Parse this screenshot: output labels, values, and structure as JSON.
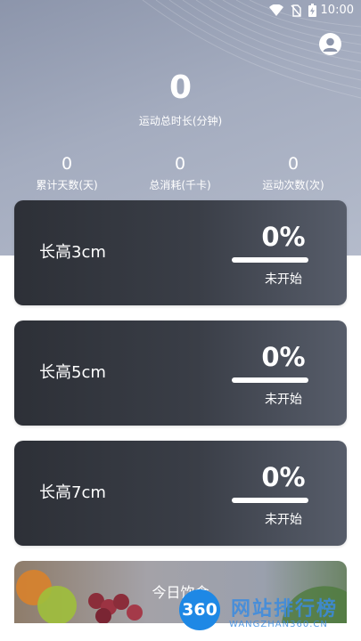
{
  "status_bar": {
    "time": "10:00"
  },
  "summary": {
    "total_value": "0",
    "total_label": "运动总时长(分钟)",
    "stats": [
      {
        "value": "0",
        "label": "累计天数(天)"
      },
      {
        "value": "0",
        "label": "总消耗(千卡)"
      },
      {
        "value": "0",
        "label": "运动次数(次)"
      }
    ]
  },
  "plans": [
    {
      "name": "长高3cm",
      "percent": "0%",
      "status": "未开始"
    },
    {
      "name": "长高5cm",
      "percent": "0%",
      "status": "未开始"
    },
    {
      "name": "长高7cm",
      "percent": "0%",
      "status": "未开始"
    }
  ],
  "diet": {
    "title": "今日饮食"
  },
  "watermark": {
    "logo": "360",
    "text": "网站排行榜",
    "sub": "WANGZHAN360.CN"
  },
  "colors": {
    "header": "#9ba3b7",
    "card": "#2f333b",
    "accent_white": "#ffffff"
  },
  "icons": [
    "wifi-icon",
    "no-sim-icon",
    "battery-charging-icon",
    "user-avatar-icon"
  ]
}
